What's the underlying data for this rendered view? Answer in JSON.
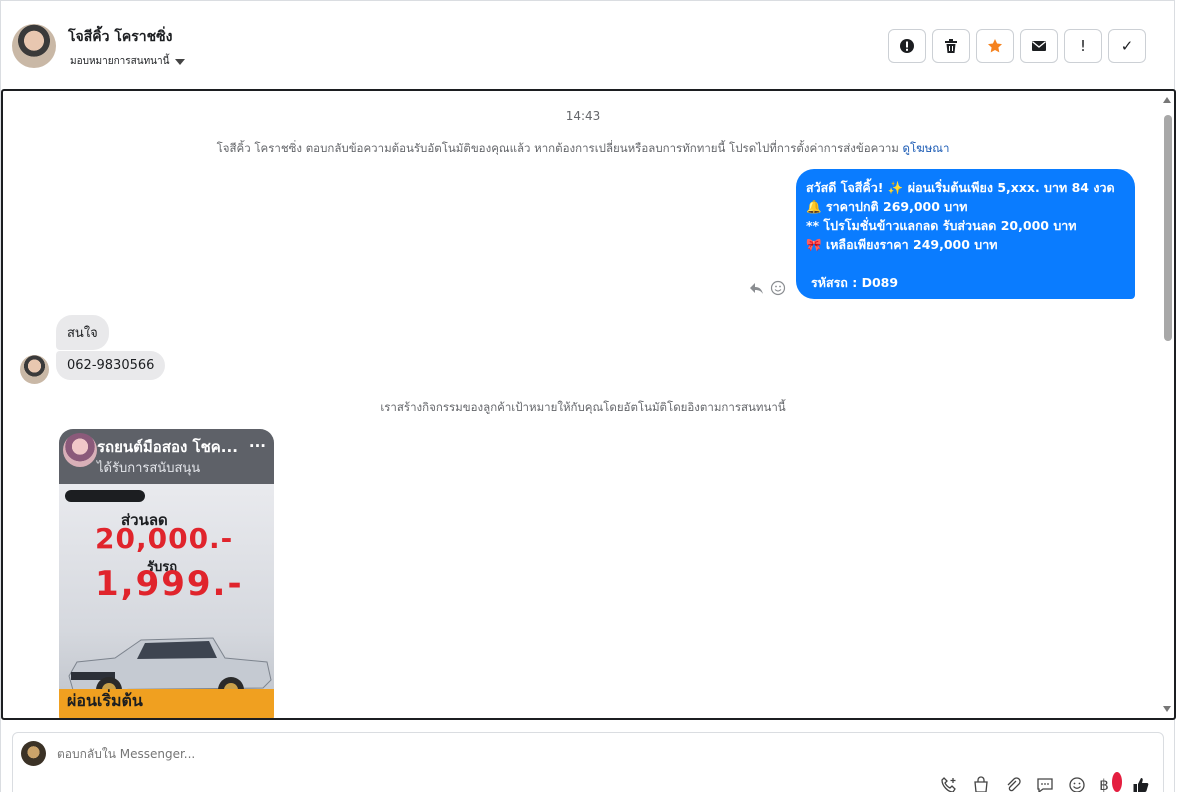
{
  "header": {
    "contact_name": "โจสีคิ้ว โคราชซิ่ง",
    "assign_label": "มอบหมายการสนทนานี้",
    "toolbar": [
      {
        "name": "report-icon",
        "label": "!"
      },
      {
        "name": "trash-icon",
        "label": ""
      },
      {
        "name": "star-icon",
        "label": ""
      },
      {
        "name": "mail-icon",
        "label": ""
      },
      {
        "name": "exclamation-icon",
        "label": "!"
      },
      {
        "name": "check-icon",
        "label": "✓"
      }
    ],
    "accent_star": "#f5821f"
  },
  "chat": {
    "timestamp": "14:43",
    "auto_reply_notice": "โจสีคิ้ว โคราชซิ่ง ตอบกลับข้อความต้อนรับอัตโนมัติของคุณแล้ว หากต้องการเปลี่ยนหรือลบการทักทายนี้ โปรดไปที่การตั้งค่าการส่งข้อความ",
    "auto_reply_link": "ดูโฆษณา",
    "outgoing": {
      "line1": "สวัสดี โจสีคิ้ว! ✨  ผ่อนเริ่มต้นเพียง 5,xxx. บาท 84 งวด",
      "line2": "🔔 ราคาปกติ 269,000 บาท",
      "line3": "** โปรโมชั่นข้าวแลกลด รับส่วนลด 20,000 บาท",
      "line4": "🎀  เหลือเพียงราคา 249,000 บาท",
      "line5": "รหัสรถ : D089",
      "color": "#0a7cff"
    },
    "incoming": [
      {
        "text": "สนใจ"
      },
      {
        "text": "062-9830566"
      }
    ],
    "activity_notice": "เราสร้างกิจกรรมของลูกค้าเป้าหมายให้กับคุณโดยอัตโนมัติโดยอิงตามการสนทนานี้",
    "ad_card": {
      "title": "รถยนต์มือสอง โชค...",
      "subtitle": "ได้รับการสนับสนุน",
      "more": "...",
      "discount_label": "ส่วนลด",
      "discount": "20,000.-",
      "receive_label": "รับรถ",
      "receive": "1,999.-",
      "banner": "ผ่อนเริ่มต้น"
    }
  },
  "composer": {
    "placeholder": "ตอบกลับใน Messenger...",
    "icons": [
      "phone-plus-icon",
      "shopping-bag-icon",
      "paperclip-icon",
      "chat-icon",
      "emoji-icon",
      "baht-icon",
      "thumbs-up-icon"
    ],
    "baht_symbol": "฿"
  }
}
